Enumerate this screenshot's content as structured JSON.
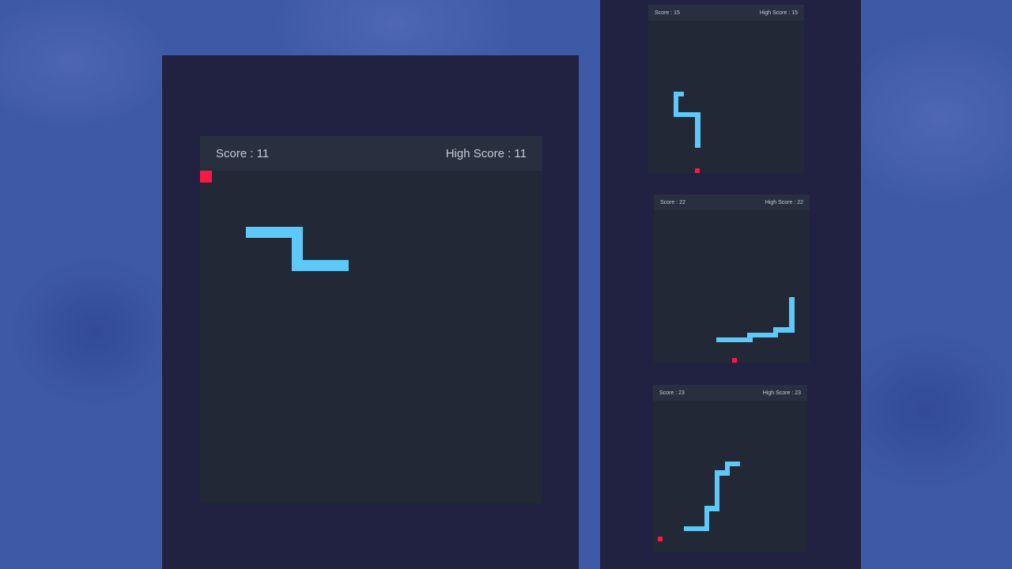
{
  "colors": {
    "snake": "#5ec8f8",
    "food": "#ff1744",
    "panel": "#212142",
    "board": "#222836",
    "header": "#28303f",
    "header_text": "#c4cbd6"
  },
  "games": [
    {
      "score_label": "Score : 11",
      "high_score_label": "High Score : 11",
      "score": 11,
      "high_score": 11
    },
    {
      "score_label": "Score : 15",
      "high_score_label": "High Score : 15",
      "score": 15,
      "high_score": 15
    },
    {
      "score_label": "Score : 22",
      "high_score_label": "High Score : 22",
      "score": 22,
      "high_score": 22
    },
    {
      "score_label": "Score : 23",
      "high_score_label": "High Score : 23",
      "score": 23,
      "high_score": 23
    }
  ]
}
